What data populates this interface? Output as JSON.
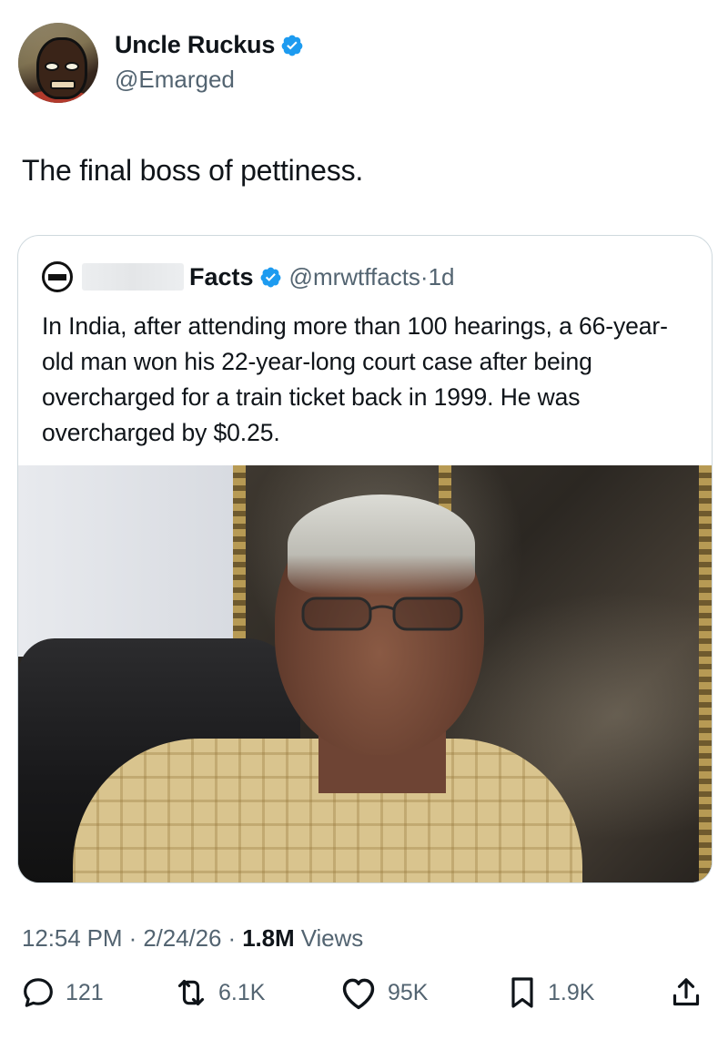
{
  "author": {
    "display_name": "Uncle Ruckus",
    "handle": "@Emarged",
    "verified": true
  },
  "tweet": {
    "text": "The final boss of pettiness."
  },
  "quoted": {
    "name": "Facts",
    "handle": "@mrwtffacts",
    "separator": "·",
    "age": "1d",
    "text": "In India, after attending more than 100 hearings, a 66-year-old man won his 22-year-long court case after being overcharged for a train ticket back in 1999. He was overcharged by $0.25."
  },
  "meta": {
    "time": "12:54 PM",
    "separator": "·",
    "date": "2/24/26",
    "views_count": "1.8M",
    "views_label": "Views"
  },
  "actions": {
    "replies": "121",
    "reposts": "6.1K",
    "likes": "95K",
    "bookmarks": "1.9K"
  },
  "colors": {
    "text_primary": "#0f1419",
    "text_secondary": "#536471",
    "verified_blue": "#1d9bf0",
    "card_border": "#cfd9de"
  },
  "icons": [
    "verified-badge-icon",
    "reply-icon",
    "repost-icon",
    "like-icon",
    "bookmark-icon",
    "share-icon"
  ]
}
